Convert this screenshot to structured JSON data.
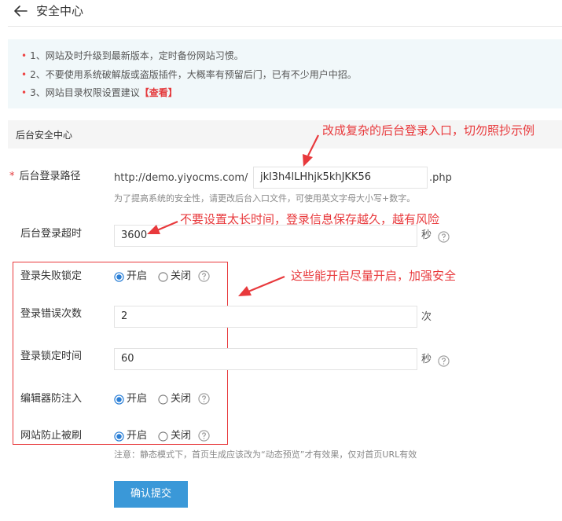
{
  "header": {
    "title": "安全中心"
  },
  "tips": {
    "items": [
      "1、网站及时升级到最新版本，定时备份网站习惯。",
      "2、不要使用系统破解版或盗版插件，大概率有预留后门，已有不少用户中招。",
      "3、网站目录权限设置建议"
    ],
    "link_label": "【查看】"
  },
  "section": {
    "title": "后台安全中心"
  },
  "form": {
    "admin_path": {
      "label": "后台登录路径",
      "prefix": "http://demo.yiyocms.com/",
      "value": "jkl3h4lLHhjk5khJKK56",
      "suffix": ".php",
      "hint": "为了提高系统的安全性，请更改后台入口文件，可使用英文字母大小写+数字。"
    },
    "login_timeout": {
      "label": "后台登录超时",
      "value": "3600",
      "unit": "秒"
    },
    "login_fail_lock": {
      "label": "登录失败锁定",
      "on": "开启",
      "off": "关闭",
      "selected": "on"
    },
    "login_error_count": {
      "label": "登录错误次数",
      "value": "2",
      "unit": "次"
    },
    "lock_time": {
      "label": "登录锁定时间",
      "value": "60",
      "unit": "秒"
    },
    "editor_injection": {
      "label": "编辑器防注入",
      "on": "开启",
      "off": "关闭",
      "selected": "on"
    },
    "anti_flood": {
      "label": "网站防止被刷",
      "on": "开启",
      "off": "关闭",
      "selected": "on",
      "note": "注意：静态模式下，首页生成应该改为“动态预览”才有效果，仅对首页URL有效"
    },
    "submit_label": "确认提交"
  },
  "annotations": {
    "path": "改成复杂的后台登录入口，切勿照抄示例",
    "timeout": "不要设置太长时间，登录信息保存越久，越有风险",
    "security": "这些能开启尽量开启，加强安全"
  },
  "colors": {
    "accent": "#3a98d8",
    "annotation": "#e8393c",
    "tips_bg": "#f1f8fa"
  }
}
